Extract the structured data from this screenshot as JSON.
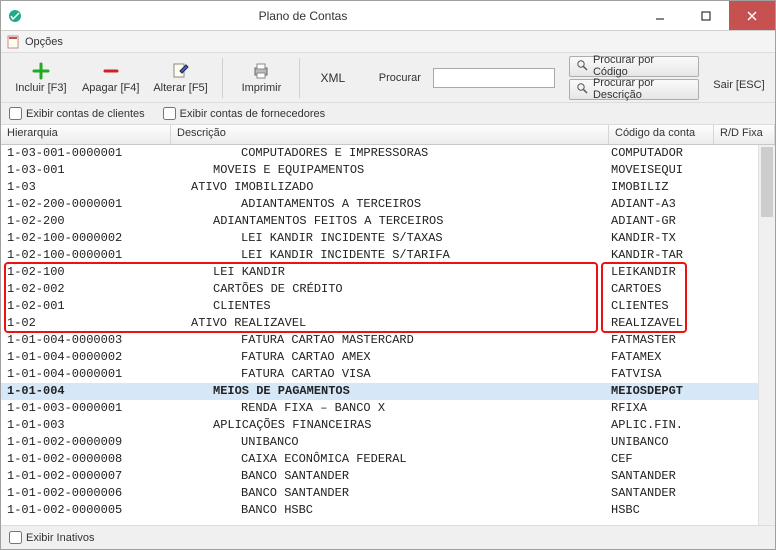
{
  "window": {
    "title": "Plano de Contas"
  },
  "menu": {
    "options": "Opções"
  },
  "toolbar": {
    "include": "Incluir [F3]",
    "delete": "Apagar [F4]",
    "edit": "Alterar [F5]",
    "print": "Imprimir",
    "xml": "XML",
    "search_label": "Procurar",
    "search_placeholder": "",
    "search_by_code": "Procurar por Código",
    "search_by_desc": "Procurar por Descrição",
    "exit": "Sair [ESC]"
  },
  "filters": {
    "show_client_accounts": "Exibir contas de clientes",
    "show_supplier_accounts": "Exibir contas de fornecedores"
  },
  "grid": {
    "headers": {
      "hier": "Hierarquia",
      "desc": "Descrição",
      "code": "Código da conta",
      "rd": "R/D Fixa"
    },
    "rows": [
      {
        "hier": "1-01-002-0000005",
        "indent": 5,
        "desc": "BANCO HSBC",
        "code": "HSBC",
        "sel": false
      },
      {
        "hier": "1-01-002-0000006",
        "indent": 5,
        "desc": "BANCO SANTANDER",
        "code": "SANTANDER",
        "sel": false
      },
      {
        "hier": "1-01-002-0000007",
        "indent": 5,
        "desc": "BANCO SANTANDER",
        "code": "SANTANDER",
        "sel": false
      },
      {
        "hier": "1-01-002-0000008",
        "indent": 5,
        "desc": "CAIXA ECONÔMICA FEDERAL",
        "code": "CEF",
        "sel": false
      },
      {
        "hier": "1-01-002-0000009",
        "indent": 5,
        "desc": "UNIBANCO",
        "code": "UNIBANCO",
        "sel": false
      },
      {
        "hier": "1-01-003",
        "indent": 3,
        "desc": "APLICAÇÕES FINANCEIRAS",
        "code": "APLIC.FIN.",
        "sel": false
      },
      {
        "hier": "1-01-003-0000001",
        "indent": 5,
        "desc": "RENDA FIXA – BANCO X",
        "code": "RFIXA",
        "sel": false
      },
      {
        "hier": "1-01-004",
        "indent": 3,
        "desc": "MEIOS DE PAGAMENTOS",
        "code": "MEIOSDEPGT",
        "sel": true
      },
      {
        "hier": "1-01-004-0000001",
        "indent": 5,
        "desc": "FATURA CARTAO VISA",
        "code": "FATVISA",
        "sel": false
      },
      {
        "hier": "1-01-004-0000002",
        "indent": 5,
        "desc": "FATURA CARTAO AMEX",
        "code": "FATAMEX",
        "sel": false
      },
      {
        "hier": "1-01-004-0000003",
        "indent": 5,
        "desc": "FATURA CARTAO MASTERCARD",
        "code": "FATMASTER",
        "sel": false
      },
      {
        "hier": "1-02",
        "indent": 2,
        "desc": "ATIVO REALIZAVEL",
        "code": "REALIZAVEL",
        "sel": false
      },
      {
        "hier": "1-02-001",
        "indent": 3,
        "desc": "CLIENTES",
        "code": "CLIENTES",
        "sel": false
      },
      {
        "hier": "1-02-002",
        "indent": 3,
        "desc": "CARTÕES DE CRÉDITO",
        "code": "CARTOES",
        "sel": false
      },
      {
        "hier": "1-02-100",
        "indent": 3,
        "desc": "LEI KANDIR",
        "code": "LEIKANDIR",
        "sel": false
      },
      {
        "hier": "1-02-100-0000001",
        "indent": 5,
        "desc": "LEI KANDIR INCIDENTE S/TARIFA",
        "code": "KANDIR-TAR",
        "sel": false
      },
      {
        "hier": "1-02-100-0000002",
        "indent": 5,
        "desc": "LEI KANDIR INCIDENTE S/TAXAS",
        "code": "KANDIR-TX",
        "sel": false
      },
      {
        "hier": "1-02-200",
        "indent": 3,
        "desc": "ADIANTAMENTOS FEITOS A TERCEIROS",
        "code": "ADIANT-GR",
        "sel": false
      },
      {
        "hier": "1-02-200-0000001",
        "indent": 5,
        "desc": "ADIANTAMENTOS A TERCEIROS",
        "code": "ADIANT-A3",
        "sel": false
      },
      {
        "hier": "1-03",
        "indent": 2,
        "desc": "ATIVO IMOBILIZADO",
        "code": "IMOBILIZ",
        "sel": false
      },
      {
        "hier": "1-03-001",
        "indent": 3,
        "desc": "MOVEIS E EQUIPAMENTOS",
        "code": "MOVEISEQUI",
        "sel": false
      },
      {
        "hier": "1-03-001-0000001",
        "indent": 5,
        "desc": "COMPUTADORES E IMPRESSORAS",
        "code": "COMPUTADOR",
        "sel": false
      }
    ]
  },
  "footer": {
    "show_inactive": "Exibir Inativos"
  },
  "highlight": {
    "top_row_index": 7,
    "row_count": 4
  },
  "colors": {
    "accent": "#d6e8f8",
    "highlight_border": "#e11"
  }
}
